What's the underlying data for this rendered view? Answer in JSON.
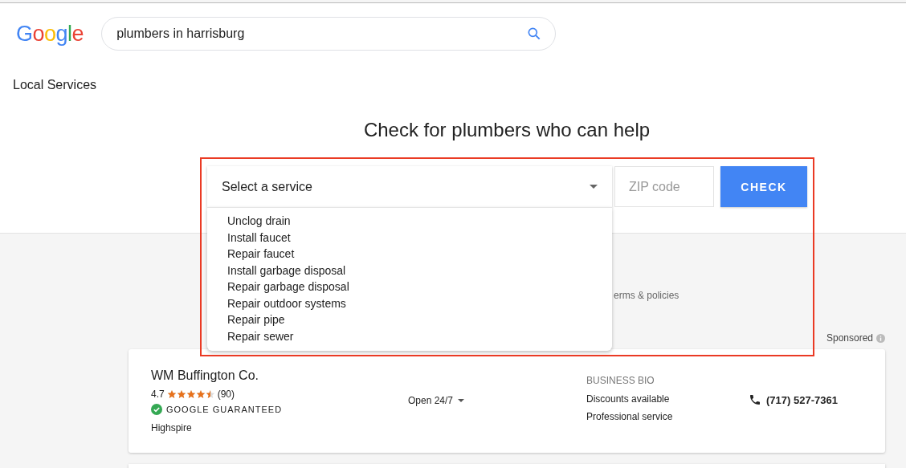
{
  "logo": "Google",
  "search": {
    "value": "plumbers in harrisburg"
  },
  "section_title": "Local Services",
  "heading": "Check for plumbers who can help",
  "form": {
    "service_select": {
      "value": "Select a service",
      "expanded": true,
      "options": [
        "Unclog drain",
        "Install faucet",
        "Repair faucet",
        "Install garbage disposal",
        "Repair garbage disposal",
        "Repair outdoor systems",
        "Repair pipe",
        "Repair sewer"
      ]
    },
    "zip": {
      "placeholder": "ZIP code"
    },
    "button": "CHECK"
  },
  "terms_link": "erms & policies",
  "sponsored": "Sponsored",
  "listings": [
    {
      "name": "WM Buffington Co.",
      "rating": "4.7",
      "stars": 4.5,
      "reviews": "(90)",
      "badge": "GOOGLE GUARANTEED",
      "location": "Highspire",
      "hours": "Open 24/7",
      "bio_label": "BUSINESS BIO",
      "bio": [
        "Discounts available",
        "Professional service"
      ],
      "phone": "(717) 527-7361"
    }
  ]
}
